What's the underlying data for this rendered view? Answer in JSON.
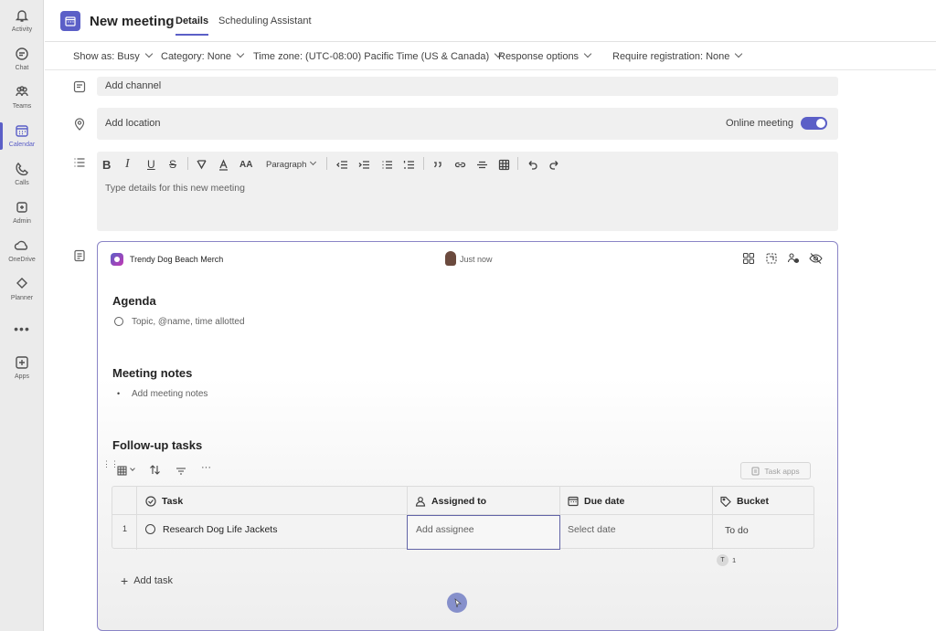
{
  "rail": {
    "items": [
      {
        "label": "Activity",
        "icon": "bell-icon"
      },
      {
        "label": "Chat",
        "icon": "chat-icon"
      },
      {
        "label": "Teams",
        "icon": "teams-icon"
      },
      {
        "label": "Calendar",
        "icon": "calendar-icon",
        "active": true
      },
      {
        "label": "Calls",
        "icon": "phone-icon"
      },
      {
        "label": "Admin",
        "icon": "admin-icon"
      },
      {
        "label": "OneDrive",
        "icon": "cloud-icon"
      },
      {
        "label": "Planner",
        "icon": "planner-icon"
      },
      {
        "label": "Apps",
        "icon": "add-apps-icon"
      }
    ],
    "more": "•••"
  },
  "header": {
    "title": "New meeting",
    "tabs": [
      "Details",
      "Scheduling Assistant"
    ]
  },
  "options": {
    "show_as": "Show as: Busy",
    "category": "Category: None",
    "timezone": "Time zone: (UTC-08:00) Pacific Time (US & Canada)",
    "response": "Response options",
    "registration": "Require registration: None"
  },
  "form": {
    "channel_placeholder": "Add channel",
    "location_placeholder": "Add location",
    "online_meeting_label": "Online meeting",
    "online_meeting_on": true,
    "details_placeholder": "Type details for this new meeting"
  },
  "toolbar": {
    "bold": "B",
    "italic": "I",
    "underline": "U",
    "strike": "S",
    "font_size": "AA",
    "paragraph": "Paragraph"
  },
  "loop": {
    "workspace": "Trendy Dog Beach Merch",
    "timestamp": "Just now",
    "agenda_title": "Agenda",
    "agenda_placeholder": "Topic, @name, time allotted",
    "notes_title": "Meeting notes",
    "notes_placeholder": "Add meeting notes",
    "tasks_title": "Follow-up tasks",
    "task_apps": "Task apps",
    "columns": [
      "Task",
      "Assigned to",
      "Due date",
      "Bucket"
    ],
    "rows": [
      {
        "num": "1",
        "task": "Research Dog Life Jackets",
        "assignee": "Add assignee",
        "due": "Select date",
        "bucket": "To do"
      }
    ],
    "presence_initial": "T",
    "presence_count": "1",
    "add_task": "Add task"
  },
  "colors": {
    "accent": "#5b5fc7",
    "rail": "#ebebeb",
    "field": "#f0f0f0"
  }
}
